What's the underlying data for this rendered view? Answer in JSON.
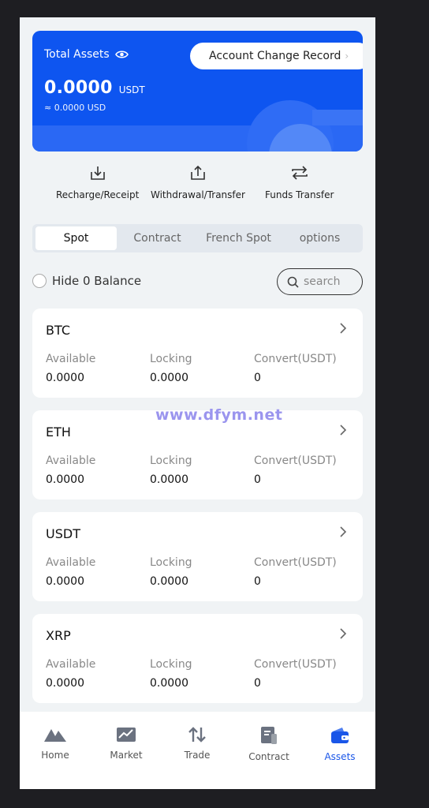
{
  "header": {
    "total_assets_label": "Total Assets",
    "amount": "0.0000",
    "unit": "USDT",
    "approx": "≈ 0.0000 USD",
    "account_change_label": "Account Change Record",
    "accent": "#0e55f0"
  },
  "actions": [
    {
      "label": "Recharge/Receipt",
      "icon": "download-icon"
    },
    {
      "label": "Withdrawal/Transfer",
      "icon": "upload-icon"
    },
    {
      "label": "Funds Transfer",
      "icon": "swap-icon"
    }
  ],
  "tabs": [
    {
      "label": "Spot",
      "active": true
    },
    {
      "label": "Contract",
      "active": false
    },
    {
      "label": "French Spot",
      "active": false
    },
    {
      "label": "options",
      "active": false
    }
  ],
  "filter": {
    "hide_zero_label": "Hide 0 Balance",
    "search_placeholder": "search"
  },
  "columns": {
    "available": "Available",
    "locking": "Locking",
    "convert": "Convert(USDT)"
  },
  "coins": [
    {
      "name": "BTC",
      "available": "0.0000",
      "locking": "0.0000",
      "convert": "0"
    },
    {
      "name": "ETH",
      "available": "0.0000",
      "locking": "0.0000",
      "convert": "0"
    },
    {
      "name": "USDT",
      "available": "0.0000",
      "locking": "0.0000",
      "convert": "0"
    },
    {
      "name": "XRP",
      "available": "0.0000",
      "locking": "0.0000",
      "convert": "0"
    }
  ],
  "watermark": "www.dfym.net",
  "nav": [
    {
      "label": "Home",
      "icon": "home-icon",
      "active": false
    },
    {
      "label": "Market",
      "icon": "chart-icon",
      "active": false
    },
    {
      "label": "Trade",
      "icon": "trade-arrows-icon",
      "active": false
    },
    {
      "label": "Contract",
      "icon": "document-icon",
      "active": false
    },
    {
      "label": "Assets",
      "icon": "wallet-icon",
      "active": true
    }
  ]
}
